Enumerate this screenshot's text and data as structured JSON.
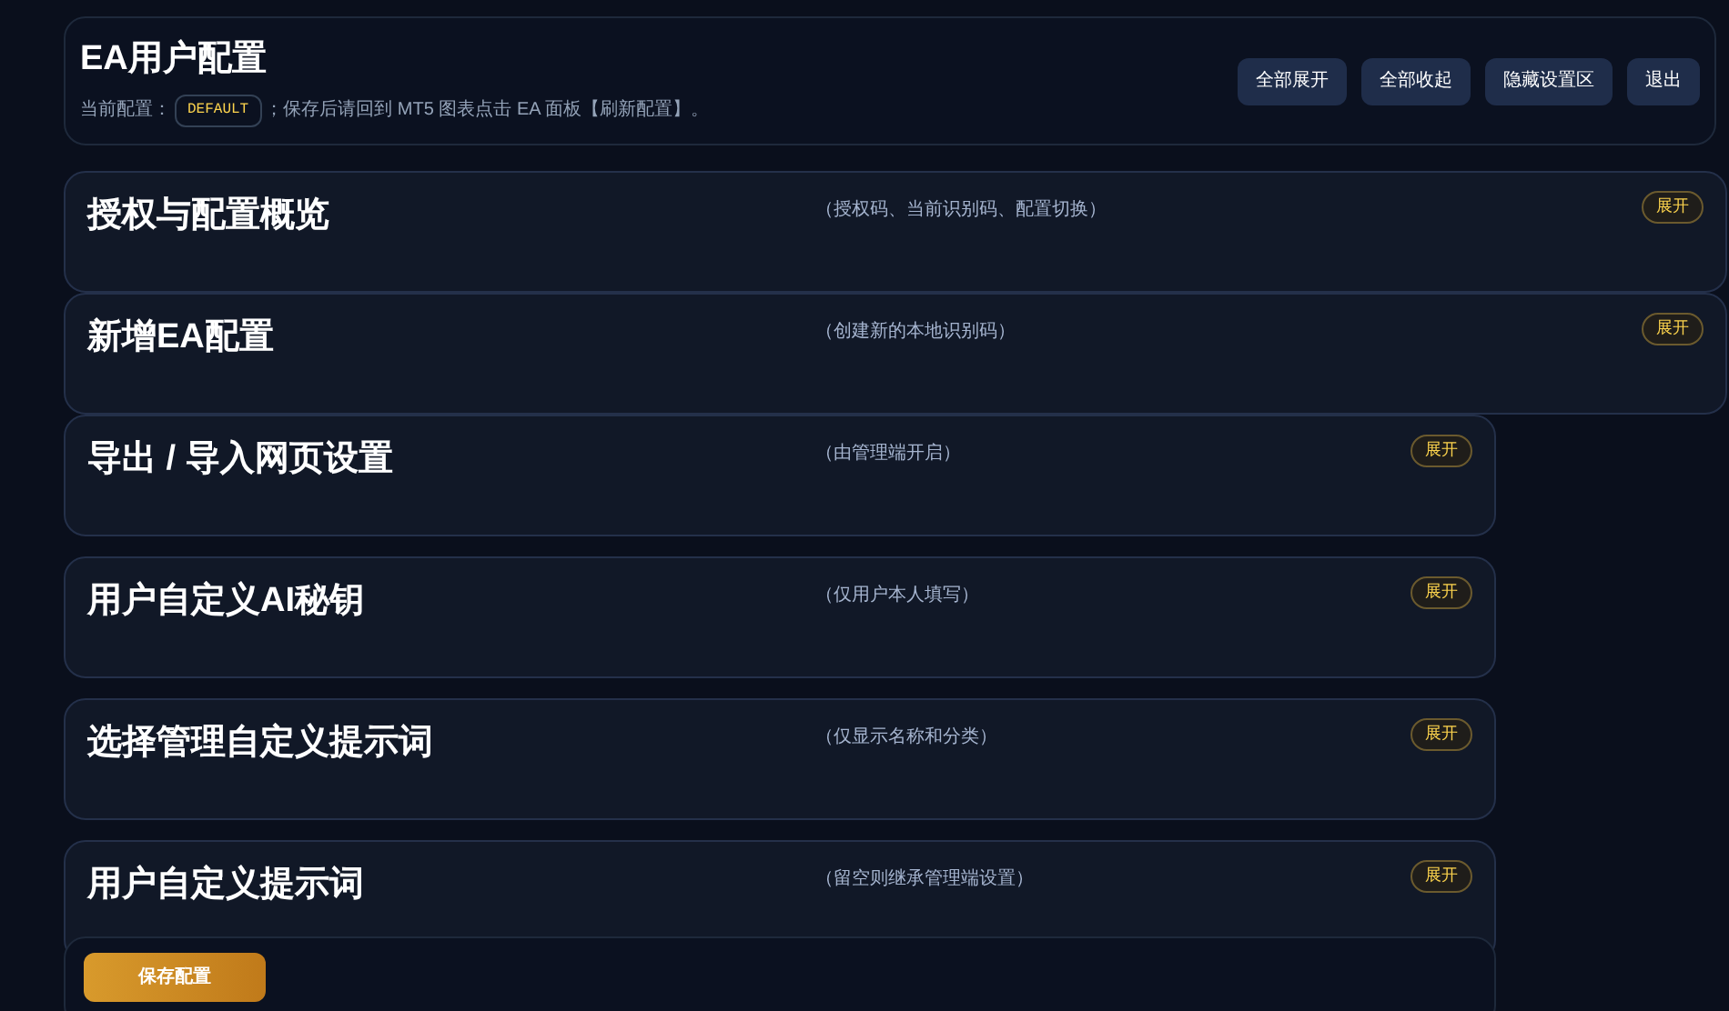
{
  "header": {
    "title": "EA用户配置",
    "current_label": "当前配置：",
    "profile": "DEFAULT",
    "note": "；保存后请回到 MT5 图表点击 EA 面板【刷新配置】。",
    "buttons": [
      "全部展开",
      "全部收起",
      "隐藏设置区",
      "退出"
    ]
  },
  "sections": [
    {
      "title": "授权与配置概览",
      "hint": "（授权码、当前识别码、配置切换）",
      "toggle": "展开",
      "wide": true
    },
    {
      "title": "新增EA配置",
      "hint": "（创建新的本地识别码）",
      "toggle": "展开",
      "wide": true
    },
    {
      "title": "导出 / 导入网页设置",
      "hint": "（由管理端开启）",
      "toggle": "展开",
      "wide": false
    },
    {
      "title": "用户自定义AI秘钥",
      "hint": "（仅用户本人填写）",
      "toggle": "展开",
      "wide": false
    },
    {
      "title": "选择管理自定义提示词",
      "hint": "（仅显示名称和分类）",
      "toggle": "展开",
      "wide": false
    },
    {
      "title": "用户自定义提示词",
      "hint": "（留空则继承管理端设置）",
      "toggle": "展开",
      "wide": false
    }
  ],
  "save_button": "保存配置"
}
